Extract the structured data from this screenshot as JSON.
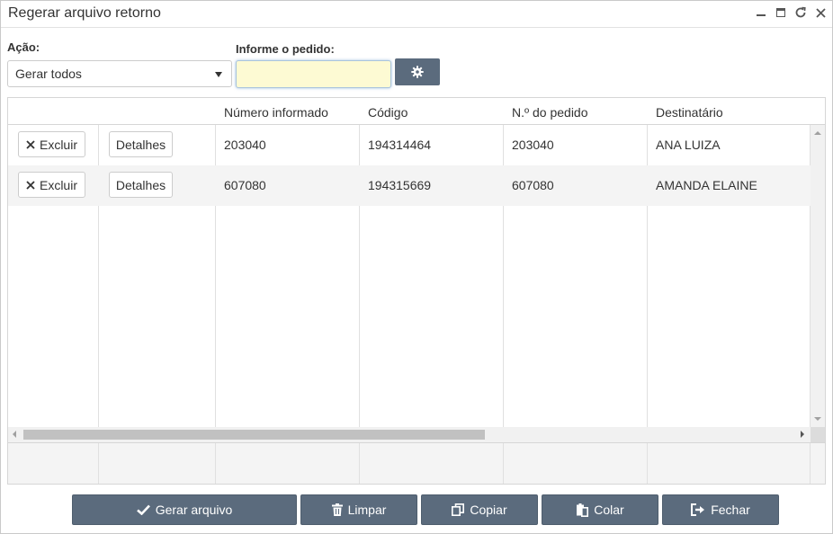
{
  "window": {
    "title": "Regerar arquivo retorno"
  },
  "form": {
    "acao_label": "Ação:",
    "acao_value": "Gerar todos",
    "pedido_label": "Informe o pedido:",
    "pedido_value": ""
  },
  "grid": {
    "columns": [
      "",
      "",
      "Número informado",
      "Código",
      "N.º do pedido",
      "Destinatário"
    ],
    "rows": [
      {
        "excluir": "Excluir",
        "detalhes": "Detalhes",
        "numero": "203040",
        "codigo": "194314464",
        "pedido": "203040",
        "destinatario": "ANA LUIZA"
      },
      {
        "excluir": "Excluir",
        "detalhes": "Detalhes",
        "numero": "607080",
        "codigo": "194315669",
        "pedido": "607080",
        "destinatario": "AMANDA ELAINE"
      }
    ]
  },
  "footer": {
    "gerar": "Gerar arquivo",
    "limpar": "Limpar",
    "copiar": "Copiar",
    "colar": "Colar",
    "fechar": "Fechar"
  },
  "icons": [
    "minimize-icon",
    "maximize-icon",
    "refresh-icon",
    "close-icon",
    "gear-icon",
    "x-icon",
    "check-icon",
    "trash-icon",
    "copy-icon",
    "paste-icon",
    "exit-icon"
  ]
}
